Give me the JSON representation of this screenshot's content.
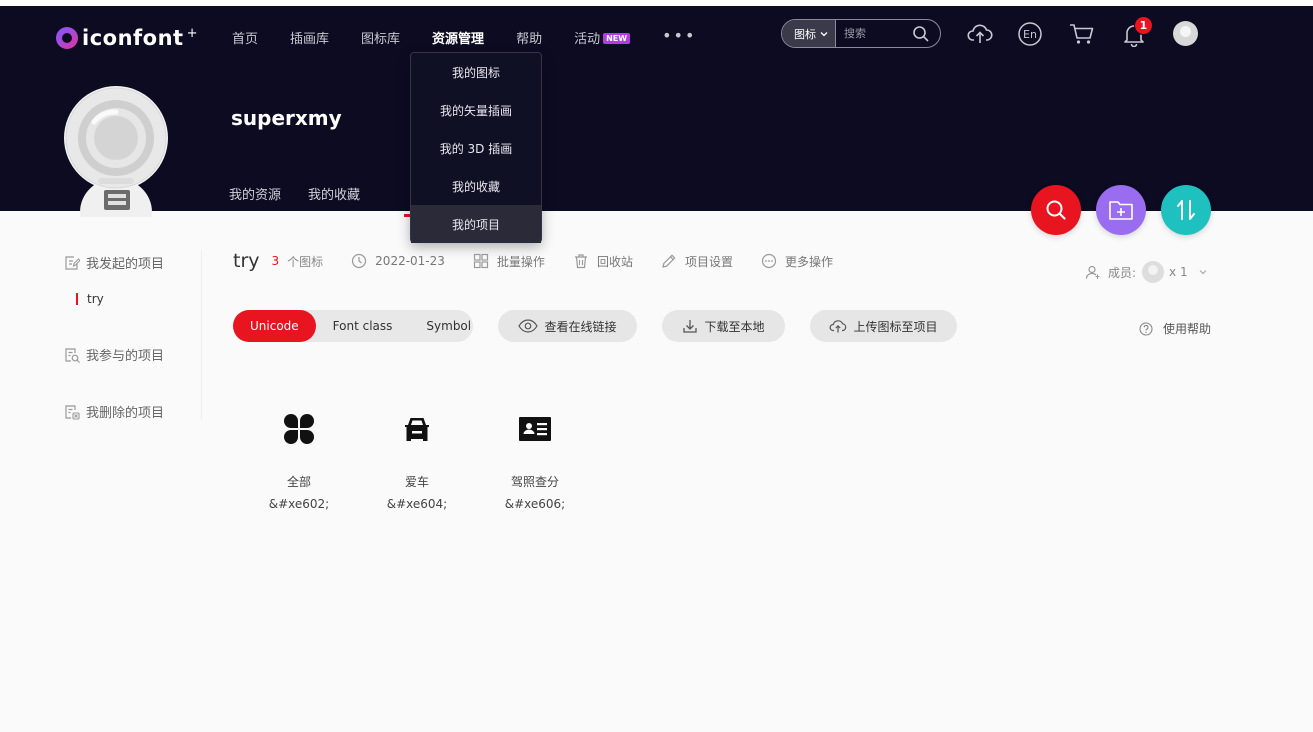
{
  "header": {
    "logo": "iconfont",
    "nav": [
      "首页",
      "插画库",
      "图标库",
      "资源管理",
      "帮助",
      "活动"
    ],
    "new_badge": "NEW",
    "search": {
      "type": "图标",
      "placeholder": "搜索"
    },
    "notification_count": "1"
  },
  "dropdown": [
    "我的图标",
    "我的矢量插画",
    "我的 3D 插画",
    "我的收藏",
    "我的项目"
  ],
  "profile": {
    "username": "superxmy",
    "tabs": [
      "我的资源",
      "我的收藏"
    ]
  },
  "sidebar": {
    "created": "我发起的项目",
    "created_item": "try",
    "joined": "我参与的项目",
    "deleted": "我删除的项目"
  },
  "project": {
    "name": "try",
    "count": "3",
    "count_label": "个图标",
    "date": "2022-01-23",
    "actions": [
      "批量操作",
      "回收站",
      "项目设置",
      "更多操作"
    ],
    "members_label": "成员:",
    "members_count": "x 1"
  },
  "toolbar": {
    "segments": [
      "Unicode",
      "Font class",
      "Symbol"
    ],
    "view_link": "查看在线链接",
    "download": "下载至本地",
    "upload": "上传图标至项目",
    "help": "使用帮助"
  },
  "icons": [
    {
      "name": "全部",
      "code": "&#xe602;",
      "glyph": "clover-icon"
    },
    {
      "name": "爱车",
      "code": "&#xe604;",
      "glyph": "car-icon"
    },
    {
      "name": "驾照查分",
      "code": "&#xe606;",
      "glyph": "id-card-icon"
    }
  ],
  "colors": {
    "primary": "#e8141f",
    "header_bg": "#0d0b21",
    "fab_search": "#e8141f",
    "fab_folder": "#9a6cf0",
    "fab_sort": "#1fc0c0"
  }
}
